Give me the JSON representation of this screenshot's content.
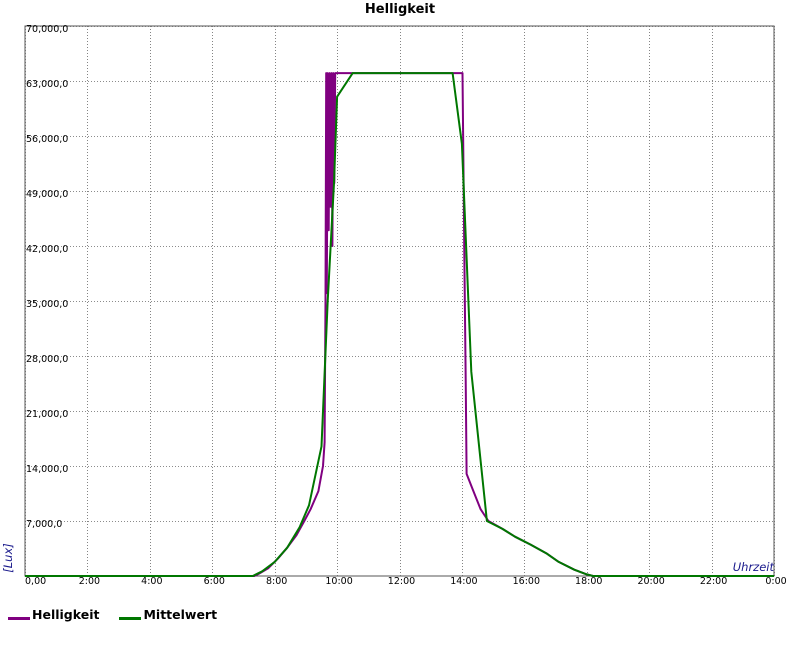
{
  "chart_data": {
    "type": "line",
    "title": "Helligkeit",
    "xlabel": "Uhrzeit",
    "ylabel": "[Lux]",
    "xlim": [
      0,
      24
    ],
    "ylim": [
      0,
      70000
    ],
    "x_ticks": [
      "0,00",
      "2:00",
      "4:00",
      "6:00",
      "8:00",
      "10:00",
      "12:00",
      "14:00",
      "16:00",
      "18:00",
      "20:00",
      "22:00",
      "0:00"
    ],
    "y_ticks": [
      "70,000,0",
      "63,000,0",
      "56,000,0",
      "49,000,0",
      "42,000,0",
      "35,000,0",
      "28,000,0",
      "21,000,0",
      "14,000,0",
      "7,000,0"
    ],
    "grid": true,
    "legend_position": "bottom-left",
    "series": [
      {
        "name": "Helligkeit",
        "color": "#800080",
        "points": [
          [
            0,
            0
          ],
          [
            7.35,
            0
          ],
          [
            7.5,
            300
          ],
          [
            7.8,
            1000
          ],
          [
            8.1,
            2200
          ],
          [
            8.4,
            3600
          ],
          [
            8.7,
            5200
          ],
          [
            8.95,
            7000
          ],
          [
            9.15,
            8500
          ],
          [
            9.4,
            10800
          ],
          [
            9.55,
            14000
          ],
          [
            9.6,
            17000
          ],
          [
            9.63,
            35000
          ],
          [
            9.65,
            64000
          ],
          [
            9.67,
            36000
          ],
          [
            9.7,
            64000
          ],
          [
            9.73,
            44000
          ],
          [
            9.76,
            64000
          ],
          [
            9.79,
            47000
          ],
          [
            9.82,
            64000
          ],
          [
            9.85,
            42000
          ],
          [
            9.88,
            64000
          ],
          [
            9.91,
            50000
          ],
          [
            9.94,
            64000
          ],
          [
            13.97,
            64000
          ],
          [
            14.02,
            64000
          ],
          [
            14.08,
            40000
          ],
          [
            14.12,
            25000
          ],
          [
            14.15,
            13000
          ],
          [
            14.35,
            11000
          ],
          [
            14.6,
            8500
          ],
          [
            14.85,
            7000
          ],
          [
            15.3,
            6000
          ],
          [
            15.7,
            5000
          ],
          [
            16.2,
            4000
          ],
          [
            16.7,
            2900
          ],
          [
            17.1,
            1800
          ],
          [
            17.6,
            800
          ],
          [
            18.0,
            200
          ],
          [
            18.2,
            0
          ],
          [
            24,
            0
          ]
        ]
      },
      {
        "name": "Mittelwert",
        "color": "#007700",
        "points": [
          [
            0,
            0
          ],
          [
            7.3,
            0
          ],
          [
            7.6,
            600
          ],
          [
            8.0,
            1800
          ],
          [
            8.4,
            3600
          ],
          [
            8.8,
            6200
          ],
          [
            9.1,
            9000
          ],
          [
            9.5,
            16500
          ],
          [
            9.7,
            35000
          ],
          [
            9.9,
            50000
          ],
          [
            10.0,
            61000
          ],
          [
            10.5,
            64000
          ],
          [
            13.7,
            64000
          ],
          [
            14.0,
            55000
          ],
          [
            14.3,
            26000
          ],
          [
            14.8,
            7000
          ],
          [
            15.3,
            6000
          ],
          [
            15.7,
            5000
          ],
          [
            16.2,
            4000
          ],
          [
            16.7,
            2900
          ],
          [
            17.1,
            1800
          ],
          [
            17.6,
            800
          ],
          [
            18.0,
            200
          ],
          [
            18.2,
            0
          ],
          [
            24,
            0
          ]
        ]
      }
    ]
  }
}
